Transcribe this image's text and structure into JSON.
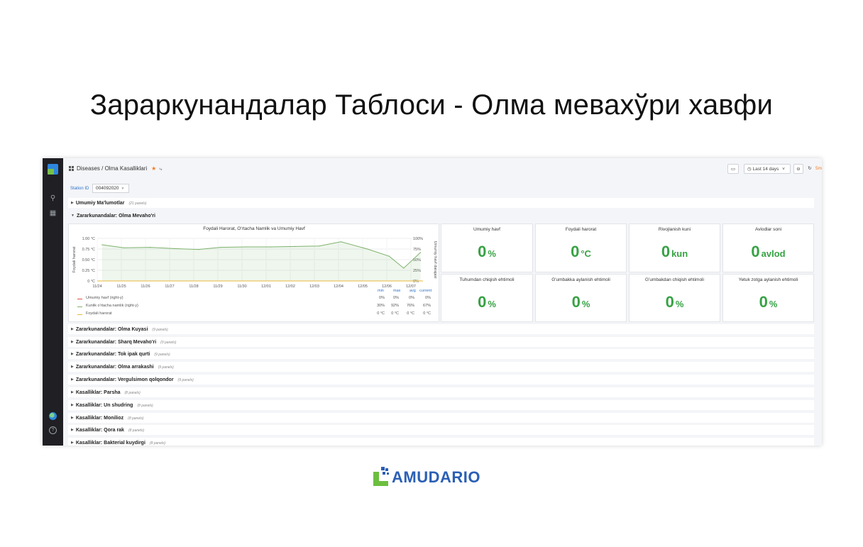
{
  "slide": {
    "title": "Зараркунандалар Таблоси - Олма мевахўри хавфи"
  },
  "colors": {
    "accent_green": "#37a244",
    "brand_blue": "#2b5fb5",
    "sidebar_bg": "#1f1f24",
    "link_blue": "#2e72c9",
    "star_orange": "#f47a20"
  },
  "sidebar": {
    "icons": [
      "search-icon",
      "dashboards-icon",
      "globe-icon",
      "help-icon"
    ]
  },
  "header": {
    "breadcrumb": "Diseases / Olma Kasalliklari",
    "time_range": "Last 14 days",
    "refresh": "5m"
  },
  "variables": {
    "station_label": "Station ID",
    "station_value": "004092020"
  },
  "rows": {
    "r0": {
      "title": "Umumiy Ma'lumotlar",
      "count": "(21 panels)"
    },
    "r1": {
      "title": "Zararkunandalar: Olma Mevaho'ri",
      "count": ""
    },
    "r2": {
      "title": "Zararkunandalar: Olma Kuyasi",
      "count": "(9 panels)"
    },
    "r3": {
      "title": "Zararkunandalar: Sharq Mevaho'ri",
      "count": "(9 panels)"
    },
    "r4": {
      "title": "Zararkunandalar: Tok ipak qurti",
      "count": "(9 panels)"
    },
    "r5": {
      "title": "Zararkunandalar: Olma arrakashi",
      "count": "(9 panels)"
    },
    "r6": {
      "title": "Zararkunandalar: Vergulsimon qolqondor",
      "count": "(9 panels)"
    },
    "r7": {
      "title": "Kasalliklar: Parsha",
      "count": "(8 panels)"
    },
    "r8": {
      "title": "Kasalliklar: Un shudring",
      "count": "(8 panels)"
    },
    "r9": {
      "title": "Kasalliklar: Monilioz",
      "count": "(8 panels)"
    },
    "r10": {
      "title": "Kasalliklar: Qora rak",
      "count": "(8 panels)"
    },
    "r11": {
      "title": "Kasalliklar: Bakterial kuydirgi",
      "count": "(8 panels)"
    }
  },
  "stats": {
    "s0": {
      "title": "Umumiy havf",
      "value": "0",
      "unit": "%"
    },
    "s1": {
      "title": "Foydali harorat",
      "value": "0",
      "unit": "°C"
    },
    "s2": {
      "title": "Rivojlanish kuni",
      "value": "0",
      "unit": "kun"
    },
    "s3": {
      "title": "Avlodlar soni",
      "value": "0",
      "unit": "avlod"
    },
    "s4": {
      "title": "Tuhumdan chiqish ehtimoli",
      "value": "0",
      "unit": "%"
    },
    "s5": {
      "title": "G'umbakka aylanish ehtimoli",
      "value": "0",
      "unit": "%"
    },
    "s6": {
      "title": "G'umbakdan chiqish ehtimoli",
      "value": "0",
      "unit": "%"
    },
    "s7": {
      "title": "Yetuk zotga aylanish ehtimoli",
      "value": "0",
      "unit": "%"
    }
  },
  "chart_data": {
    "type": "line",
    "title": "Foydali Harorat, O'rtacha Namlik va Umumiy Havf",
    "ylabel": "Foydali harorat",
    "ylabel_right": "Umumiy havf darajasi",
    "x": [
      "11/24",
      "11/25",
      "11/26",
      "11/27",
      "11/28",
      "11/29",
      "11/30",
      "12/01",
      "12/02",
      "12/03",
      "12/04",
      "12/05",
      "12/06",
      "12/07"
    ],
    "y_ticks_left": [
      "1.00 °C",
      "0.75 °C",
      "0.50 °C",
      "0.25 °C",
      "0 °C"
    ],
    "y_ticks_right": [
      "100%",
      "75%",
      "50%",
      "25%",
      "0%"
    ],
    "ylim_left": [
      0,
      1
    ],
    "ylim_right": [
      0,
      100
    ],
    "grid": true,
    "series": [
      {
        "name": "Umumiy havf (right-y)",
        "color": "#e24d42",
        "axis": "right",
        "x": [
          0,
          13.5
        ],
        "values": [
          0,
          0
        ],
        "min": "0%",
        "max": "0%",
        "avg": "0%",
        "current": "0%"
      },
      {
        "name": "Kunlik o'rtacha namlik (right-y)",
        "color": "#7eb26d",
        "axis": "right",
        "x": [
          0.2,
          1.1,
          2.2,
          3.2,
          4.2,
          5.1,
          6.2,
          7.2,
          8.2,
          9.2,
          10.1,
          11.2,
          12.1,
          12.7,
          13.4
        ],
        "values": [
          85,
          78,
          79,
          76,
          74,
          79,
          80,
          80,
          81,
          82,
          92,
          75,
          58,
          30,
          67
        ],
        "min": "30%",
        "max": "92%",
        "avg": "76%",
        "current": "67%"
      },
      {
        "name": "Foydali harorat",
        "color": "#eab839",
        "axis": "left",
        "x": [
          0,
          13.5
        ],
        "values": [
          0,
          0
        ],
        "min": "0 °C",
        "max": "0 °C",
        "avg": "0 °C",
        "current": "0 °C"
      }
    ],
    "legend_columns": [
      "min",
      "max",
      "avg",
      "current"
    ]
  },
  "brand": {
    "name": "AMUDARIO"
  }
}
